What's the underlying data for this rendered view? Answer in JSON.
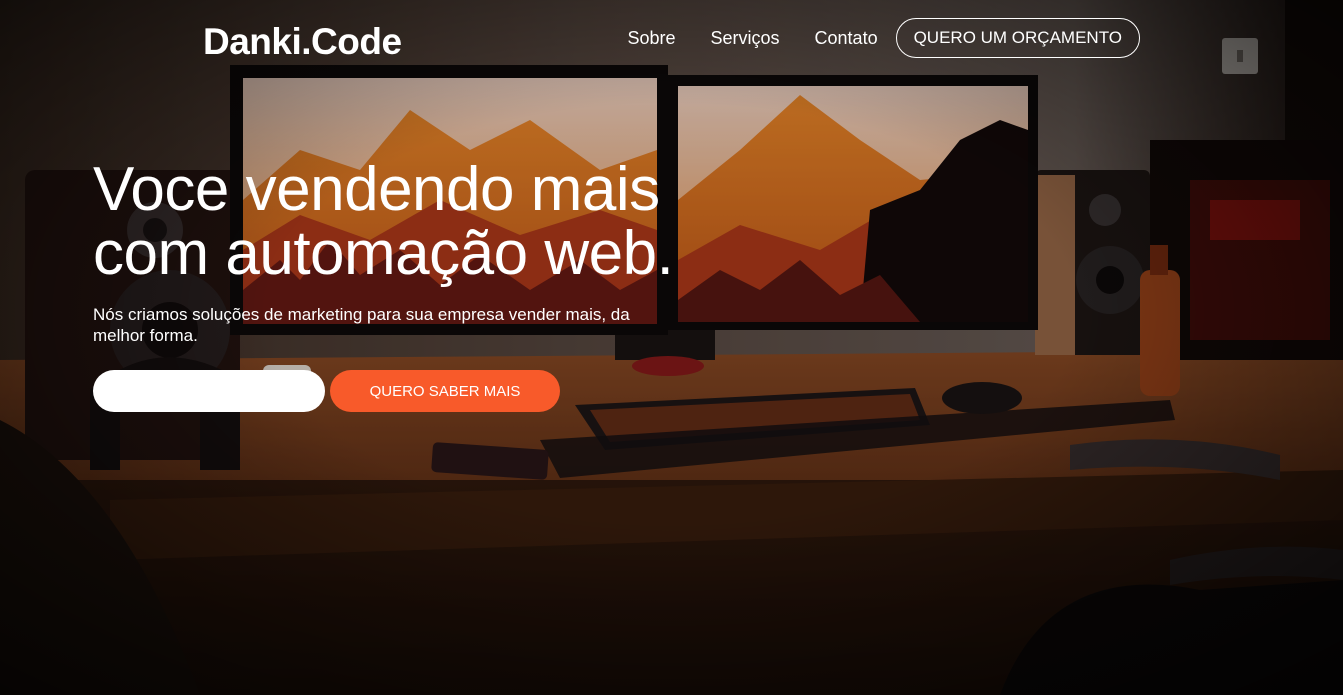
{
  "brand": {
    "name": "Danki.Code"
  },
  "nav": {
    "items": [
      {
        "label": "Sobre"
      },
      {
        "label": "Serviços"
      },
      {
        "label": "Contato"
      }
    ],
    "cta_label": "QUERO UM ORÇAMENTO"
  },
  "hero": {
    "headline_line1": "Voce vendendo mais",
    "headline_line2": "com automação web.",
    "subtext": "Nós criamos soluções de marketing para sua empresa vender mais, da melhor forma.",
    "input_value": "",
    "input_placeholder": "",
    "submit_label": "QUERO SABER MAIS"
  },
  "colors": {
    "accent": "#f85a2a",
    "text": "#ffffff",
    "background_dark": "#2a1a12"
  }
}
